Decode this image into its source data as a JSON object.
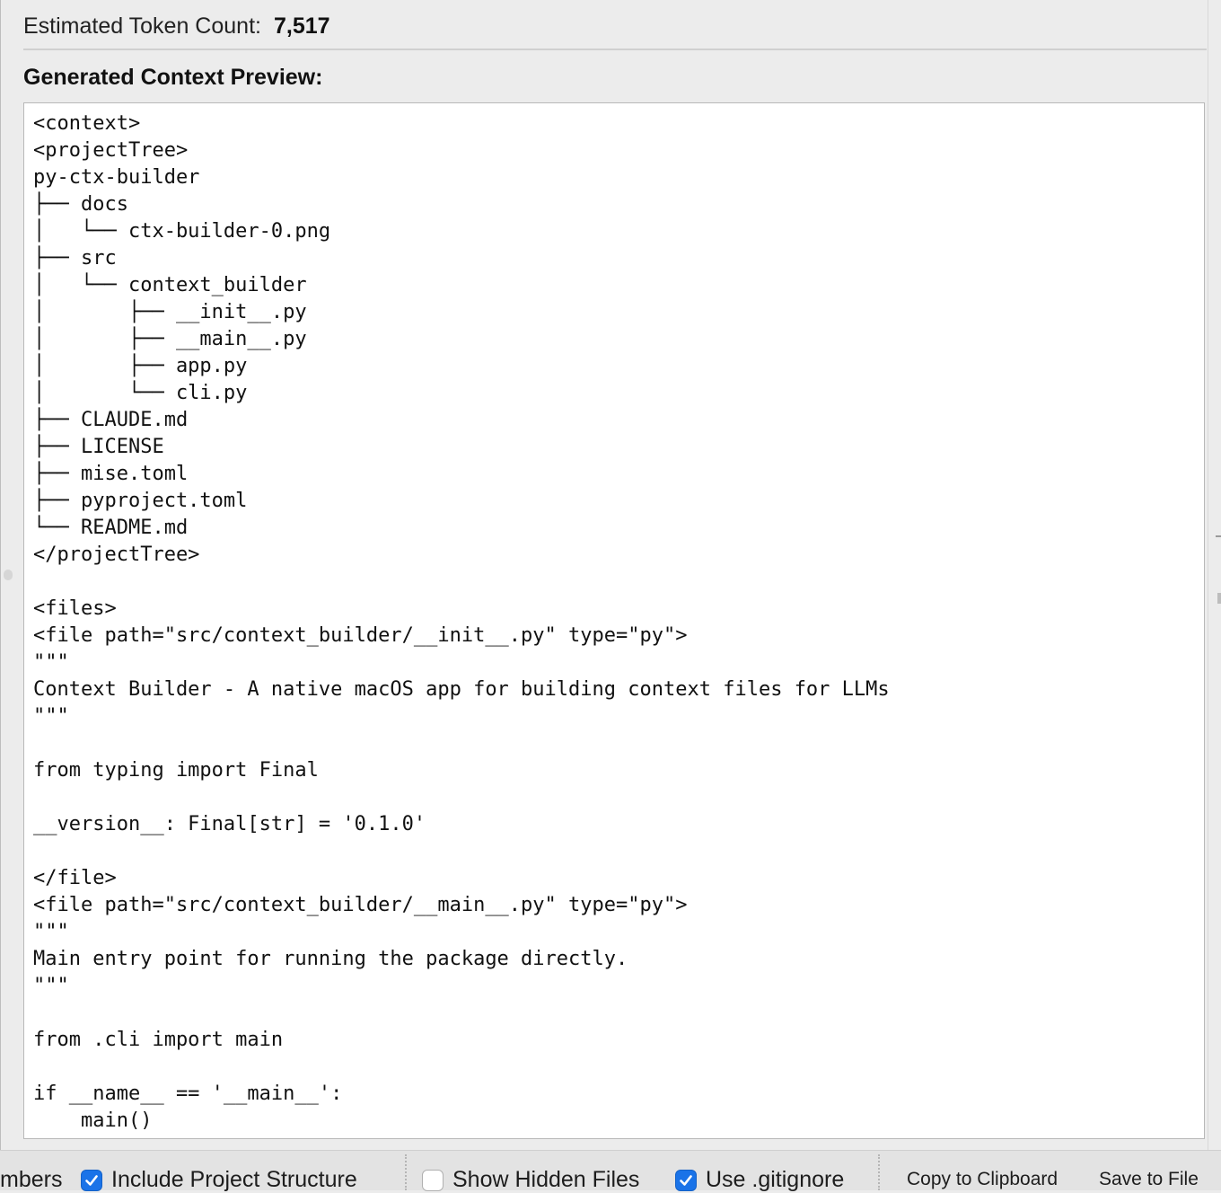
{
  "header": {
    "token_label": "Estimated Token Count:",
    "token_value": "7,517"
  },
  "preview": {
    "title": "Generated Context Preview:",
    "content": "<context>\n<projectTree>\npy-ctx-builder\n├── docs\n│   └── ctx-builder-0.png\n├── src\n│   └── context_builder\n│       ├── __init__.py\n│       ├── __main__.py\n│       ├── app.py\n│       └── cli.py\n├── CLAUDE.md\n├── LICENSE\n├── mise.toml\n├── pyproject.toml\n└── README.md\n</projectTree>\n\n<files>\n<file path=\"src/context_builder/__init__.py\" type=\"py\">\n\"\"\"\nContext Builder - A native macOS app for building context files for LLMs\n\"\"\"\n\nfrom typing import Final\n\n__version__: Final[str] = '0.1.0'\n\n</file>\n<file path=\"src/context_builder/__main__.py\" type=\"py\">\n\"\"\"\nMain entry point for running the package directly.\n\"\"\"\n\nfrom .cli import main\n\nif __name__ == '__main__':\n    main()"
  },
  "toolbar": {
    "partial_option_label": "mbers",
    "include_structure": {
      "label": "Include Project Structure",
      "checked": true
    },
    "show_hidden": {
      "label": "Show Hidden Files",
      "checked": false
    },
    "use_gitignore": {
      "label": "Use .gitignore",
      "checked": true
    },
    "copy_label": "Copy to Clipboard",
    "save_label": "Save to File"
  },
  "colors": {
    "accent": "#1a73e8",
    "background": "#ececec",
    "preview_background": "#ffffff"
  }
}
